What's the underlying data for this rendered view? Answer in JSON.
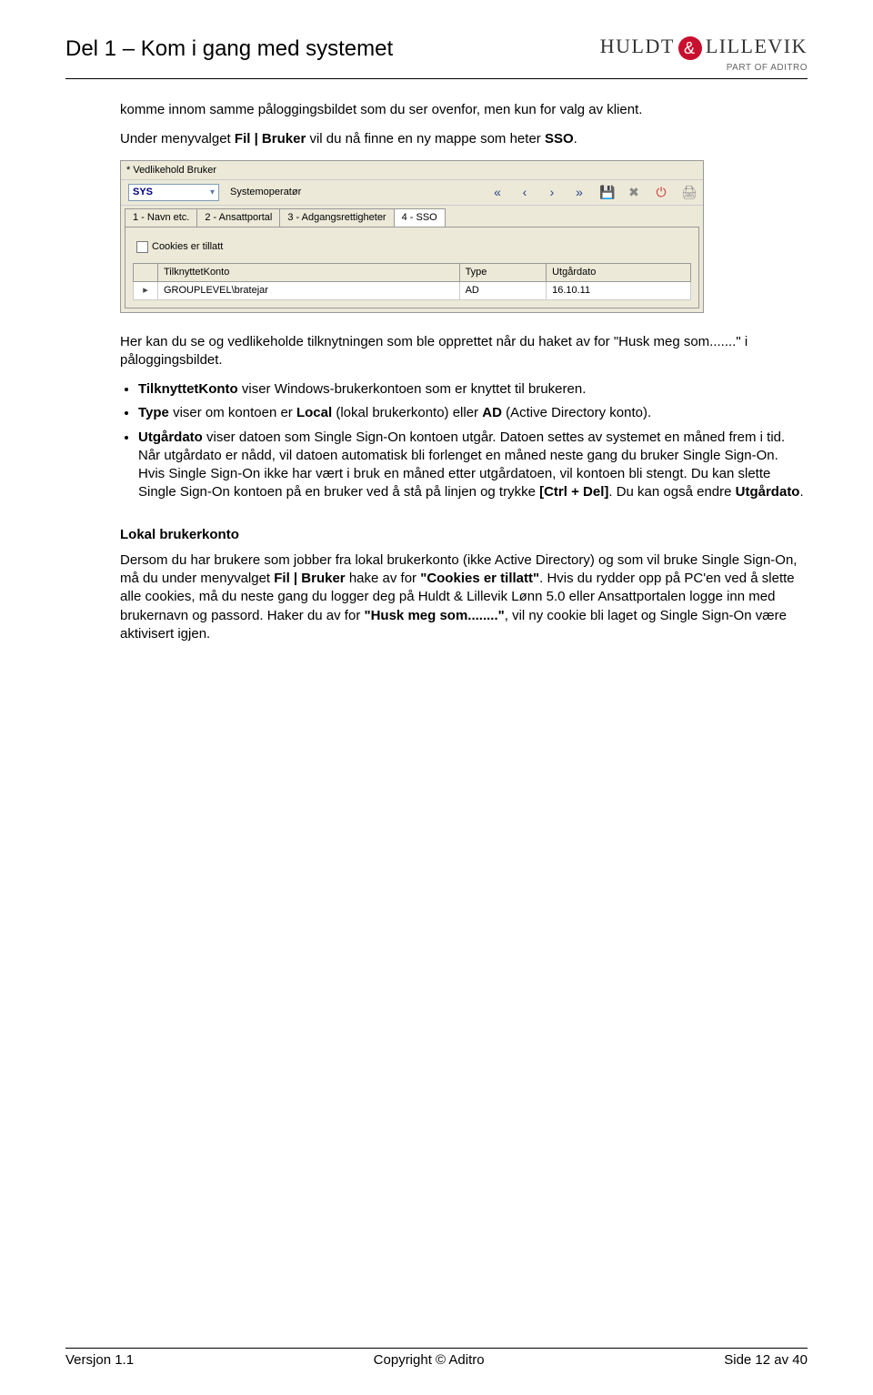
{
  "header": {
    "title": "Del 1 – Kom i gang med systemet",
    "logo_left": "HULDT",
    "logo_amp": "&",
    "logo_right": "LILLEVIK",
    "logo_sub": "PART OF ADITRO"
  },
  "para1": "komme innom samme påloggingsbildet som du ser ovenfor, men kun for valg av klient.",
  "para2_pre": "Under menyvalget ",
  "para2_bold": "Fil | Bruker",
  "para2_mid": " vil du nå finne en ny mappe som heter ",
  "para2_bold2": "SSO",
  "para2_post": ".",
  "app": {
    "title": "* Vedlikehold Bruker",
    "combo": "SYS",
    "role": "Systemoperatør",
    "tabs": [
      "1 - Navn etc.",
      "2 - Ansattportal",
      "3 - Adgangsrettigheter",
      "4 - SSO"
    ],
    "checkbox": "Cookies er tillatt",
    "columns": [
      "TilknyttetKonto",
      "Type",
      "Utgårdato"
    ],
    "row": {
      "account": "GROUPLEVEL\\bratejar",
      "type": "AD",
      "date": "16.10.11"
    }
  },
  "para3": "Her kan du se og vedlikeholde tilknytningen som ble opprettet når du haket av for \"Husk meg som.......\" i påloggingsbildet.",
  "bullet1_bold": "TilknyttetKonto",
  "bullet1_rest": " viser Windows-brukerkontoen som er knyttet til brukeren.",
  "bullet2_b1": "Type",
  "bullet2_t1": " viser om kontoen er ",
  "bullet2_b2": "Local",
  "bullet2_t2": " (lokal brukerkonto) eller ",
  "bullet2_b3": "AD",
  "bullet2_t3": " (Active Directory konto).",
  "bullet3_b1": "Utgårdato",
  "bullet3_t1": " viser datoen som Single Sign-On kontoen utgår. Datoen settes av systemet en måned frem i tid. Når utgårdato er nådd, vil datoen automatisk bli forlenget en måned neste gang du bruker Single Sign-On. Hvis Single Sign-On ikke har vært i bruk en måned etter utgårdatoen, vil kontoen bli stengt. Du kan slette Single Sign-On kontoen på en bruker ved å stå på linjen og trykke ",
  "bullet3_b2": "[Ctrl + Del]",
  "bullet3_t2": ". Du kan også endre ",
  "bullet3_b3": "Utgårdato",
  "bullet3_t3": ".",
  "section2_head": "Lokal brukerkonto",
  "p4_t1": "Dersom du har brukere som jobber fra lokal brukerkonto (ikke Active Directory) og som vil bruke Single Sign-On, må du under menyvalget ",
  "p4_b1": "Fil | Bruker",
  "p4_t2": " hake av for ",
  "p4_b2": "\"Cookies er tillatt\"",
  "p4_t3": ". Hvis du rydder opp på PC'en ved å slette alle cookies, må du neste gang du logger deg på Huldt & Lillevik Lønn 5.0 eller Ansattportalen logge inn med brukernavn og passord. Haker du av for ",
  "p4_b3": "\"Husk meg som........\"",
  "p4_t4": ", vil ny cookie bli laget og Single Sign-On være aktivisert igjen.",
  "footer": {
    "left": "Versjon 1.1",
    "center": "Copyright © Aditro",
    "right": "Side 12 av 40"
  }
}
